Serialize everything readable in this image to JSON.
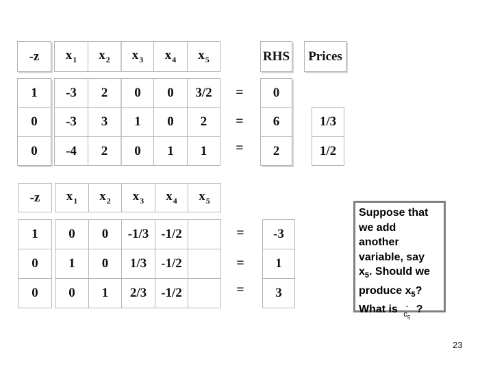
{
  "slide_number": "23",
  "tableau_initial": {
    "z_header": "-z",
    "var_headers": [
      {
        "base": "x",
        "sub": "1"
      },
      {
        "base": "x",
        "sub": "2"
      },
      {
        "base": "x",
        "sub": "3"
      },
      {
        "base": "x",
        "sub": "4"
      },
      {
        "base": "x",
        "sub": "5"
      }
    ],
    "rhs_header": "RHS",
    "prices_header": "Prices",
    "rows": [
      {
        "z": "1",
        "vars": [
          "-3",
          "2",
          "0",
          "0",
          "3/2"
        ],
        "eq": "=",
        "rhs": "0",
        "price": ""
      },
      {
        "z": "0",
        "vars": [
          "-3",
          "3",
          "1",
          "0",
          "2"
        ],
        "eq": "=",
        "rhs": "6",
        "price": "1/3"
      },
      {
        "z": "0",
        "vars": [
          "-4",
          "2",
          "0",
          "1",
          "1"
        ],
        "eq": "=",
        "rhs": "2",
        "price": "1/2"
      }
    ]
  },
  "tableau_final": {
    "z_header": "-z",
    "var_headers": [
      {
        "base": "x",
        "sub": "1"
      },
      {
        "base": "x",
        "sub": "2"
      },
      {
        "base": "x",
        "sub": "3"
      },
      {
        "base": "x",
        "sub": "4"
      },
      {
        "base": "x",
        "sub": "5"
      }
    ],
    "rows": [
      {
        "z": "1",
        "vars": [
          "0",
          "0",
          "-1/3",
          "-1/2",
          ""
        ],
        "eq": "=",
        "rhs": "-3"
      },
      {
        "z": "0",
        "vars": [
          "1",
          "0",
          "1/3",
          "-1/2",
          ""
        ],
        "eq": "=",
        "rhs": "1"
      },
      {
        "z": "0",
        "vars": [
          "0",
          "1",
          "2/3",
          "-1/2",
          ""
        ],
        "eq": "=",
        "rhs": "3"
      }
    ]
  },
  "callout": {
    "line1": "Suppose that",
    "line2": "we add",
    "line3": "another",
    "line4": "variable, say",
    "line5_var": "x",
    "line5_sub": "5",
    "line5_rest": ". Should we",
    "line6_pre": "produce ",
    "line6_var": "x",
    "line6_sub": "5",
    "line6_post": "?",
    "line7_pre": "What is ",
    "line7_sym": "c",
    "line7_sub": "5",
    "line7_post": " ?"
  }
}
